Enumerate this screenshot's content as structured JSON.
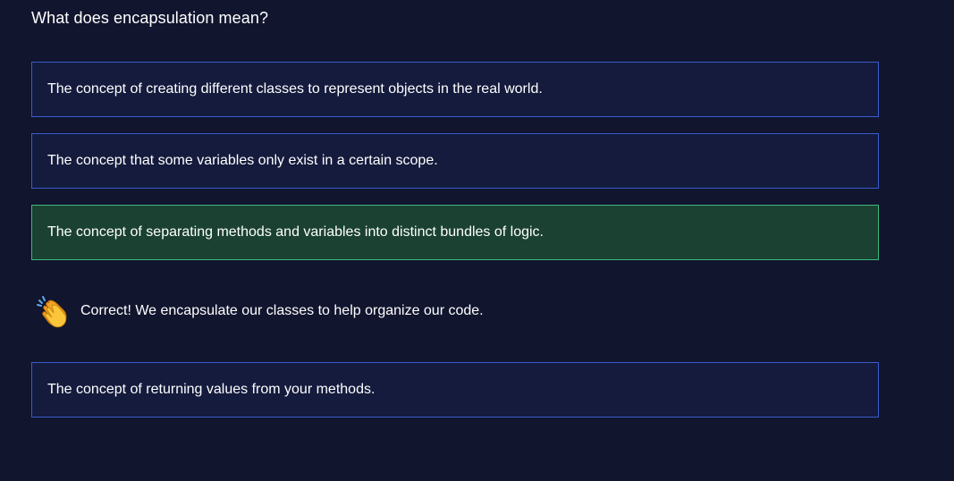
{
  "question": "What does encapsulation mean?",
  "options": [
    {
      "label": "The concept of creating different classes to represent objects in the real world.",
      "state": "default"
    },
    {
      "label": "The concept that some variables only exist in a certain scope.",
      "state": "default"
    },
    {
      "label": "The concept of separating methods and variables into distinct bundles of logic.",
      "state": "correct"
    },
    {
      "label": "The concept of returning values from your methods.",
      "state": "default"
    }
  ],
  "feedback": {
    "icon": "clapping-hands-icon",
    "text": "Correct! We encapsulate our classes to help organize our code."
  },
  "colors": {
    "background": "#11152e",
    "option_background": "#141b3d",
    "option_border": "#3a5ccc",
    "correct_background": "#1a4131",
    "correct_border": "#3fb87f"
  }
}
